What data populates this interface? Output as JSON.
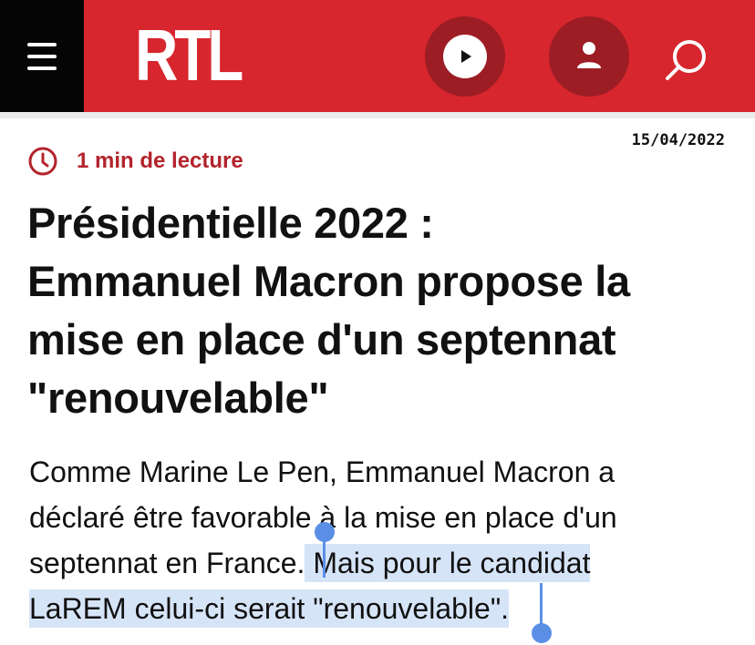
{
  "header": {
    "logo_text": "RTL",
    "brand_color": "#d7262e",
    "icons": [
      "menu-icon",
      "play-icon",
      "user-icon",
      "search-icon"
    ]
  },
  "article": {
    "date": "15/04/2022",
    "read_time": "1 min de lecture",
    "title_lines": [
      "Présidentielle 2022 :",
      "Emmanuel Macron propose la",
      "mise en place d'un septennat",
      "\"renouvelable\""
    ],
    "lede": {
      "line1": "Comme Marine Le Pen, Emmanuel Macron a",
      "line2": "déclaré être favorable à la mise en place d'un",
      "line3_plain": "septennat en France.",
      "line3_selected": " Mais pour le candidat",
      "line4_selected": "LaREM celui-ci serait \"renouvelable\"."
    }
  },
  "selection": {
    "color": "#d6e4f8",
    "handle_color": "#5b8fe6"
  }
}
